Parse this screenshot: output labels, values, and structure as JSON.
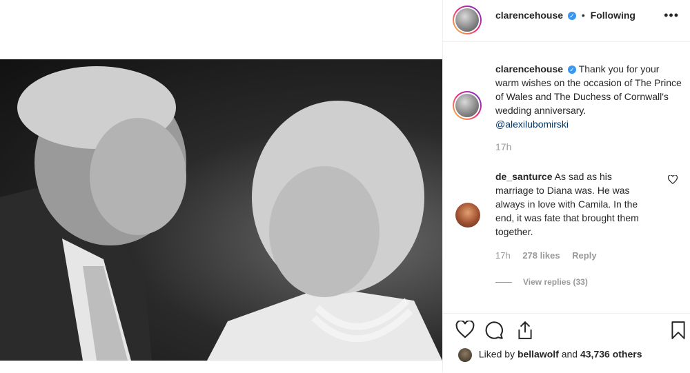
{
  "post": {
    "username": "clarencehouse",
    "follow_status": "Following",
    "more_label": "•••",
    "caption": "Thank you for your warm wishes on the occasion of The Prince of Wales and The Duchess of Cornwall's wedding anniversary.",
    "caption_credit_glyph": "",
    "caption_mention": "@alexilubomirski",
    "caption_time": "17h"
  },
  "comment": {
    "username": "de_santurce",
    "text": "As sad as his marriage to Diana was. He was always in love with Camila. In the end, it was fate that brought them together.",
    "time": "17h",
    "likes": "278 likes",
    "reply_label": "Reply",
    "view_replies": "View replies (33)"
  },
  "likes_summary": {
    "prefix": "Liked by",
    "user": "bellawolf",
    "joiner": "and",
    "count": "43,736 others"
  },
  "icons": {
    "verified": "check-icon",
    "comment_like": "heart-outline-icon",
    "like": "heart-outline-icon",
    "comment": "comment-bubble-icon",
    "share": "share-icon",
    "save": "bookmark-icon"
  },
  "colors": {
    "verified_blue": "#3897f0",
    "secondary_text": "#999999",
    "mention": "#003569"
  }
}
